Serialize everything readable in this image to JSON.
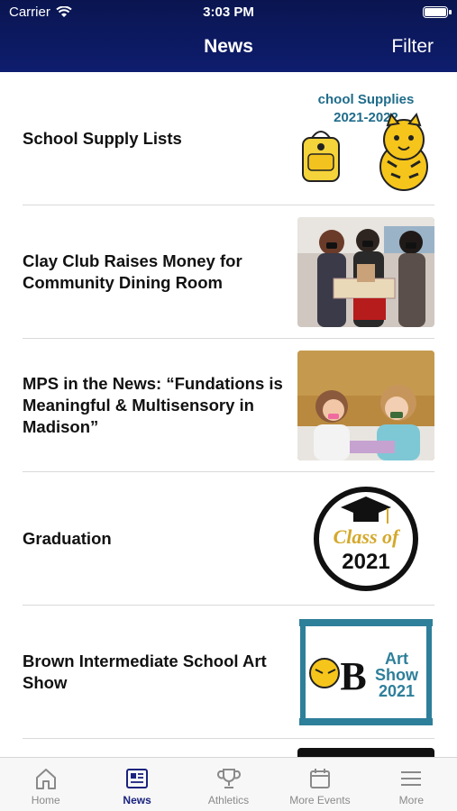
{
  "status": {
    "carrier": "Carrier",
    "time": "3:03 PM"
  },
  "nav": {
    "title": "News",
    "filter_label": "Filter"
  },
  "news": [
    {
      "title": "School Supply Lists",
      "thumb_text_1": "chool Supplies",
      "thumb_text_2": "2021-2022"
    },
    {
      "title": "Clay Club Raises Money for Community Dining Room"
    },
    {
      "title": "MPS in the News: “Fundations is Meaningful & Multisensory in Madison”"
    },
    {
      "title": "Graduation",
      "thumb_text_1": "Class of",
      "thumb_text_2": "2021"
    },
    {
      "title": "Brown Intermediate School Art Show",
      "thumb_text_1": "Art",
      "thumb_text_2": "Show",
      "thumb_text_3": "2021",
      "thumb_logo": "B"
    }
  ],
  "tabs": [
    {
      "label": "Home",
      "icon": "home-icon",
      "active": false
    },
    {
      "label": "News",
      "icon": "news-icon",
      "active": true
    },
    {
      "label": "Athletics",
      "icon": "trophy-icon",
      "active": false
    },
    {
      "label": "More Events",
      "icon": "calendar-icon",
      "active": false
    },
    {
      "label": "More",
      "icon": "menu-icon",
      "active": false
    }
  ],
  "colors": {
    "header": "#0e1d6e",
    "active_tab": "#1a237e",
    "inactive_tab": "#8a8a8a"
  }
}
